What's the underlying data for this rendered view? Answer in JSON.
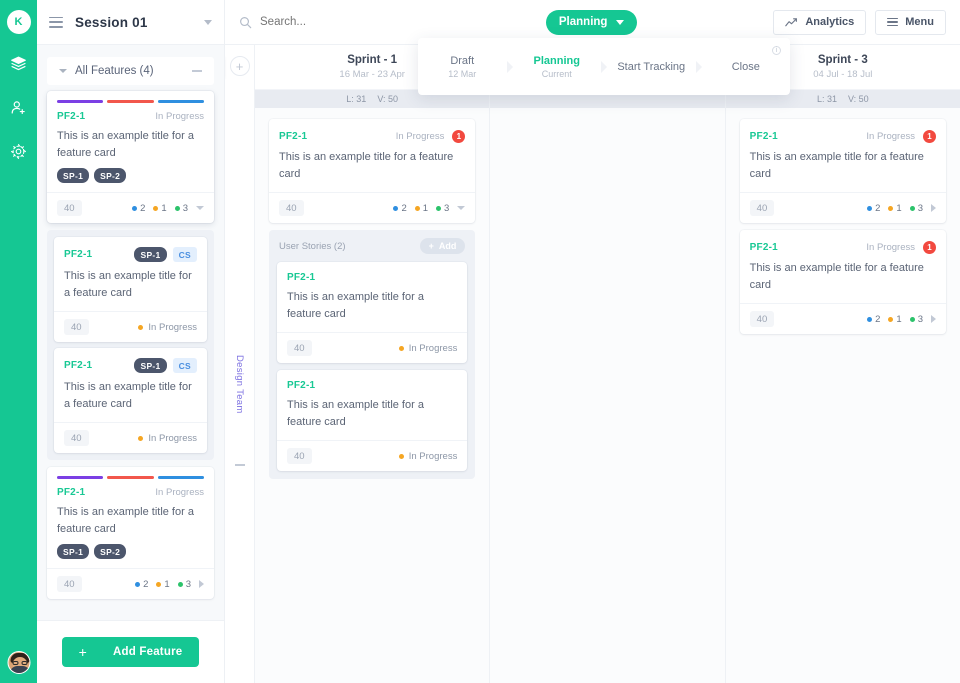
{
  "rail": {
    "logo_initial": "K",
    "icons": [
      {
        "name": "layers-icon"
      },
      {
        "name": "add-user-icon"
      },
      {
        "name": "gear-icon"
      }
    ]
  },
  "left_panel": {
    "session_title": "Session 01",
    "features_header": "All Features (4)",
    "add_feature_label": "Add Feature",
    "cards": [
      {
        "id": "PF2-1",
        "status": "In Progress",
        "title": "This is an example title for a feature card",
        "bars": [
          "#7b3fe4",
          "#f2574c",
          "#2f8fe0"
        ],
        "tags": [
          "SP-1",
          "SP-2"
        ],
        "points": "40",
        "counts": [
          {
            "color": "#2f8fe0",
            "value": "2"
          },
          {
            "color": "#f5a623",
            "value": "1"
          },
          {
            "color": "#2cc36b",
            "value": "3"
          }
        ],
        "caret": "down"
      },
      {
        "id": "PF2-1",
        "status": "In Progress",
        "title": "This is an example title for a feature card",
        "tag_dark": "SP-1",
        "tag_blue": "CS",
        "points": "40"
      },
      {
        "id": "PF2-1",
        "status": "In Progress",
        "title": "This is an example title for a feature card",
        "tag_dark": "SP-1",
        "tag_blue": "CS",
        "points": "40"
      },
      {
        "id": "PF2-1",
        "status": "In Progress",
        "title": "This is an example title for a feature card",
        "bars": [
          "#7b3fe4",
          "#f2574c",
          "#2f8fe0"
        ],
        "tags": [
          "SP-1",
          "SP-2"
        ],
        "points": "40",
        "counts": [
          {
            "color": "#2f8fe0",
            "value": "2"
          },
          {
            "color": "#f5a623",
            "value": "1"
          },
          {
            "color": "#2cc36b",
            "value": "3"
          }
        ],
        "caret": "right"
      }
    ]
  },
  "topbar": {
    "search_placeholder": "Search...",
    "search_value": "",
    "planning_label": "Planning",
    "analytics_label": "Analytics",
    "menu_label": "Menu"
  },
  "workflow": {
    "steps": [
      {
        "label": "Draft",
        "sub": "12 Mar",
        "active": false
      },
      {
        "label": "Planning",
        "sub": "Current",
        "active": true
      },
      {
        "label": "Start Tracking",
        "sub": "",
        "active": false
      },
      {
        "label": "Close",
        "sub": "",
        "active": false
      }
    ],
    "info_glyph": "i"
  },
  "board": {
    "team_label": "Design Team",
    "columns": [
      {
        "name": "Sprint - 1",
        "dates": "16 Mar - 23 Apr",
        "capacity_l": "L: 31",
        "capacity_v": "V: 50",
        "card": {
          "id": "PF2-1",
          "status": "In Progress",
          "badge": "1",
          "title": "This is an example title for a feature card",
          "points": "40",
          "counts": [
            {
              "color": "#2f8fe0",
              "value": "2"
            },
            {
              "color": "#f5a623",
              "value": "1"
            },
            {
              "color": "#2cc36b",
              "value": "3"
            }
          ]
        },
        "user_stories": {
          "header": "User Stories (2)",
          "add_label": "Add",
          "items": [
            {
              "id": "PF2-1",
              "title": "This is an example title for a feature card",
              "points": "40",
              "status": "In Progress"
            },
            {
              "id": "PF2-1",
              "title": "This is an example title for a feature card",
              "points": "40",
              "status": "In Progress"
            }
          ]
        }
      },
      {
        "name": "",
        "dates": "",
        "capacity_l": "",
        "capacity_v": ""
      },
      {
        "name": "Sprint - 3",
        "dates": "04 Jul - 18 Jul",
        "capacity_l": "L: 31",
        "capacity_v": "V: 50",
        "cards": [
          {
            "id": "PF2-1",
            "status": "In Progress",
            "badge": "1",
            "title": "This is an example title for a feature card",
            "points": "40",
            "counts": [
              {
                "color": "#2f8fe0",
                "value": "2"
              },
              {
                "color": "#f5a623",
                "value": "1"
              },
              {
                "color": "#2cc36b",
                "value": "3"
              }
            ]
          },
          {
            "id": "PF2-1",
            "status": "In Progress",
            "badge": "1",
            "title": "This is an example title for a feature card",
            "points": "40",
            "counts": [
              {
                "color": "#2f8fe0",
                "value": "2"
              },
              {
                "color": "#f5a623",
                "value": "1"
              },
              {
                "color": "#2cc36b",
                "value": "3"
              }
            ]
          }
        ]
      }
    ]
  },
  "colors": {
    "brand_green": "#15c793",
    "badge_red": "#f2493f",
    "team_purple": "#7b6fe0"
  }
}
